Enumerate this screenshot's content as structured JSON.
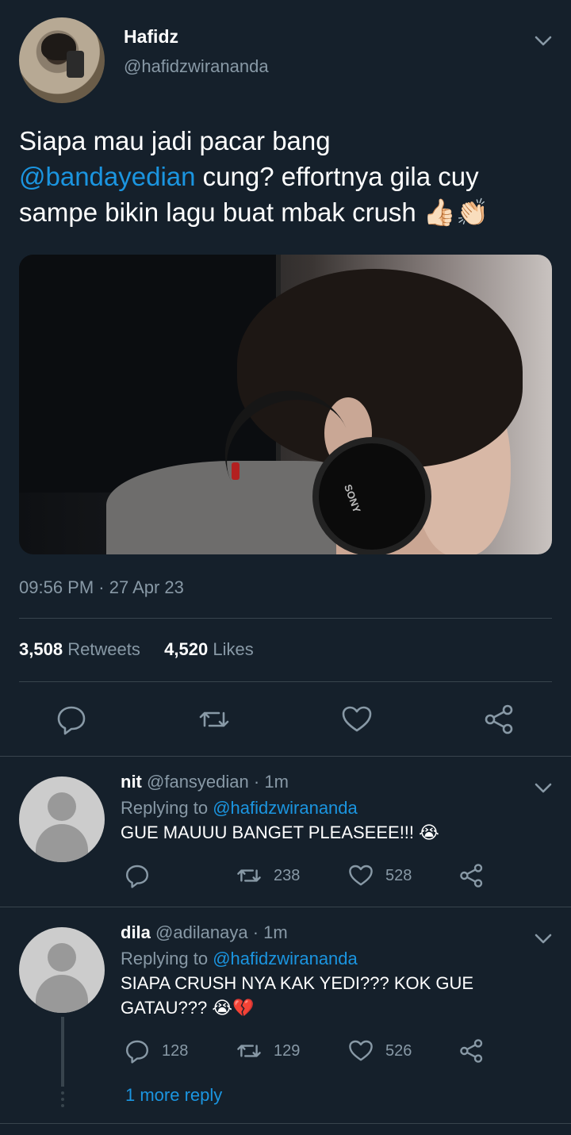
{
  "tweet": {
    "author_name": "Hafidz",
    "author_handle": "@hafidzwirananda",
    "text_line1": "Siapa mau jadi pacar bang",
    "text_mention": "@bandayedian",
    "text_line2_rest": " cung? effortnya gila cuy",
    "text_line3": "sampe bikin lagu buat mbak crush 👍🏻👏🏻",
    "timestamp": "09:56 PM · 27 Apr 23",
    "retweets_count": "3,508",
    "retweets_label": "Retweets",
    "likes_count": "4,520",
    "likes_label": "Likes",
    "photo_brand_text": "SONY"
  },
  "replies": [
    {
      "name": "nit",
      "handle": "@fansyedian",
      "time": "· 1m",
      "replying_prefix": "Replying to",
      "replying_to": "@hafidzwirananda",
      "text_line1": "GUE MAUUU BANGET PLEASEEE!!! 😭",
      "text_line2": "",
      "reply_count": "",
      "retweet_count": "238",
      "like_count": "528"
    },
    {
      "name": "dila",
      "handle": "@adilanaya",
      "time": "· 1m",
      "replying_prefix": "Replying to",
      "replying_to": "@hafidzwirananda",
      "text_line1": "SIAPA CRUSH NYA KAK YEDI??? KOK GUE",
      "text_line2": "GATAU??? 😭💔",
      "reply_count": "128",
      "retweet_count": "129",
      "like_count": "526"
    }
  ],
  "more_reply_label": "1 more reply",
  "colors": {
    "background": "#15202b",
    "link": "#1b95e0",
    "muted": "#8899a6",
    "divider": "#38444d"
  },
  "icons": [
    "reply-icon",
    "retweet-icon",
    "like-icon",
    "share-icon",
    "chevron-down-icon"
  ]
}
